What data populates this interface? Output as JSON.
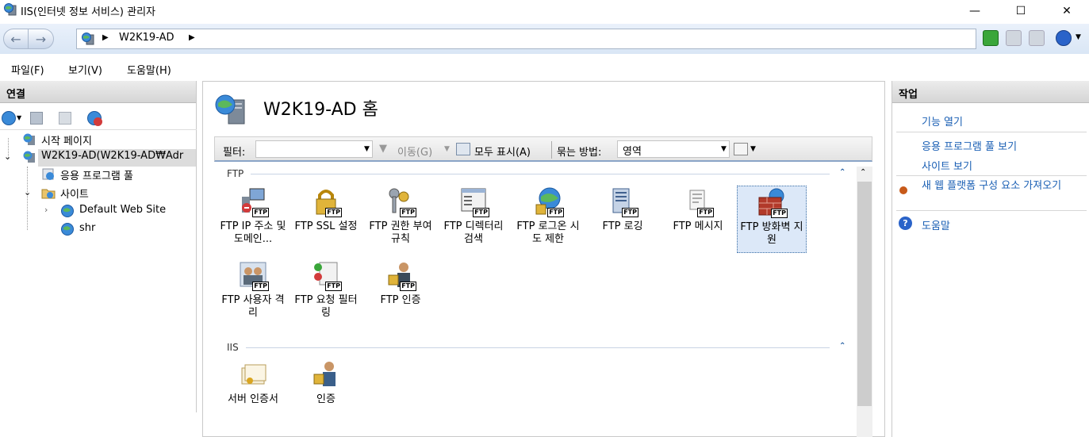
{
  "window": {
    "title": "IIS(인터넷 정보 서비스) 관리자",
    "minimize": "—",
    "maximize": "☐",
    "close": "✕"
  },
  "address": {
    "crumb": "W2K19-AD",
    "arrow": "▶"
  },
  "menu": {
    "items": [
      "파일(F)",
      "보기(V)",
      "도움말(H)"
    ]
  },
  "connections": {
    "header": "연결",
    "tree": [
      {
        "label": "시작 페이지",
        "icon": "start-page-icon"
      },
      {
        "label": "W2K19-AD(W2K19-AD₩Adr",
        "icon": "server-icon"
      },
      {
        "label": "응용 프로그램 풀",
        "icon": "app-pool-icon"
      },
      {
        "label": "사이트",
        "icon": "sites-folder-icon"
      },
      {
        "label": "Default Web Site",
        "icon": "globe-icon"
      },
      {
        "label": "shr",
        "icon": "globe-icon"
      }
    ]
  },
  "main": {
    "title": "W2K19-AD 홈",
    "filter_label": "필터:",
    "go_label": "이동(G)",
    "show_all_label": "모두 표시(A)",
    "group_label": "묶는 방법:",
    "group_value": "영역",
    "groups": [
      {
        "name": "FTP",
        "features": [
          {
            "label": "FTP IP 주소 및 도메인...",
            "icon": "ip-domain-icon"
          },
          {
            "label": "FTP SSL 설정",
            "icon": "ssl-lock-icon"
          },
          {
            "label": "FTP 권한 부여 규칙",
            "icon": "authorization-key-icon"
          },
          {
            "label": "FTP 디렉터리 검색",
            "icon": "directory-browsing-icon"
          },
          {
            "label": "FTP 로그온 시도 제한",
            "icon": "logon-globe-lock-icon"
          },
          {
            "label": "FTP 로깅",
            "icon": "logging-icon"
          },
          {
            "label": "FTP 메시지",
            "icon": "messages-icon"
          },
          {
            "label": "FTP 방화벽 지원",
            "icon": "firewall-icon"
          },
          {
            "label": "FTP 사용자 격리",
            "icon": "user-isolation-icon"
          },
          {
            "label": "FTP 요청 필터링",
            "icon": "request-filtering-icon"
          },
          {
            "label": "FTP 인증",
            "icon": "ftp-authentication-icon"
          }
        ]
      },
      {
        "name": "IIS",
        "features": [
          {
            "label": "서버 인증서",
            "icon": "server-certificates-icon"
          },
          {
            "label": "인증",
            "icon": "authentication-icon"
          }
        ]
      }
    ],
    "ftp_badge": "FTP"
  },
  "actions": {
    "header": "작업",
    "items": [
      "기능 열기",
      "응용 프로그램 풀 보기",
      "사이트 보기",
      "새 웹 플랫폼 구성 요소 가져오기",
      "도움말"
    ]
  },
  "colors": {
    "link": "#1a5fb4",
    "selected_bg": "#dce8f8"
  }
}
